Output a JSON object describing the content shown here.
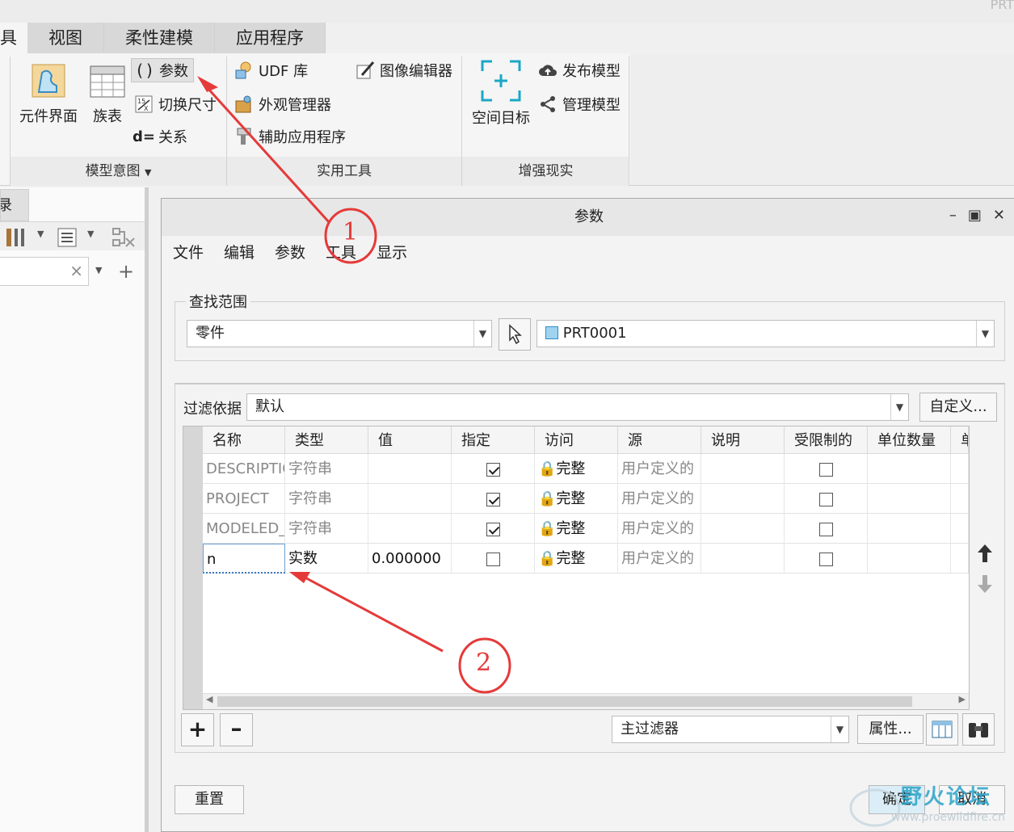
{
  "window": {
    "corner_title": "PRT"
  },
  "ribbon": {
    "tabs": [
      {
        "label": "具",
        "active": true
      },
      {
        "label": "视图"
      },
      {
        "label": "柔性建模"
      },
      {
        "label": "应用程序"
      }
    ],
    "groups": {
      "model_intent": {
        "label": "模型意图",
        "component_interface": "元件界面",
        "family_table": "族表",
        "parameters": "参数",
        "switch_dimensions": "切换尺寸",
        "relations": "关系"
      },
      "utilities": {
        "label": "实用工具",
        "udf_library": "UDF 库",
        "appearance_manager": "外观管理器",
        "auxiliary_apps": "辅助应用程序",
        "image_editor": "图像编辑器"
      },
      "ar": {
        "label": "增强现实",
        "space_target": "空间目标",
        "publish_model": "发布模型",
        "manage_model": "管理模型"
      }
    }
  },
  "left_panel": {
    "tab_label": "录"
  },
  "dialog": {
    "title": "参数",
    "menu": [
      "文件",
      "编辑",
      "参数",
      "工具",
      "显示"
    ],
    "scope": {
      "legend": "查找范围",
      "type_value": "零件",
      "object_value": "PRT0001"
    },
    "filter": {
      "label": "过滤依据",
      "value": "默认",
      "customize_button": "自定义..."
    },
    "table": {
      "columns": [
        "名称",
        "类型",
        "值",
        "指定",
        "访问",
        "源",
        "说明",
        "受限制的",
        "单位数量",
        "单"
      ],
      "rows": [
        {
          "name": "DESCRIPTIO",
          "type": "字符串",
          "value": "",
          "designate": true,
          "access": "完整",
          "source": "用户定义的",
          "restricted": false
        },
        {
          "name": "PROJECT",
          "type": "字符串",
          "value": "",
          "designate": true,
          "access": "完整",
          "source": "用户定义的",
          "restricted": false
        },
        {
          "name": "MODELED_",
          "type": "字符串",
          "value": "",
          "designate": true,
          "access": "完整",
          "source": "用户定义的",
          "restricted": false
        },
        {
          "name": "n",
          "type": "实数",
          "value": "0.000000",
          "designate": false,
          "access": "完整",
          "source": "用户定义的",
          "restricted": false
        }
      ]
    },
    "bottom": {
      "main_filter": "主过滤器",
      "properties_button": "属性...",
      "reset_button": "重置",
      "ok_button": "确定",
      "cancel_button": "取消"
    }
  },
  "annotations": {
    "one": "1",
    "two": "2"
  },
  "watermark": {
    "text": "野火论坛",
    "url": "www.proewildfire.cn"
  },
  "colors": {
    "annotation_red": "#e53a3a",
    "accent_cyan": "#1aa7c7"
  }
}
